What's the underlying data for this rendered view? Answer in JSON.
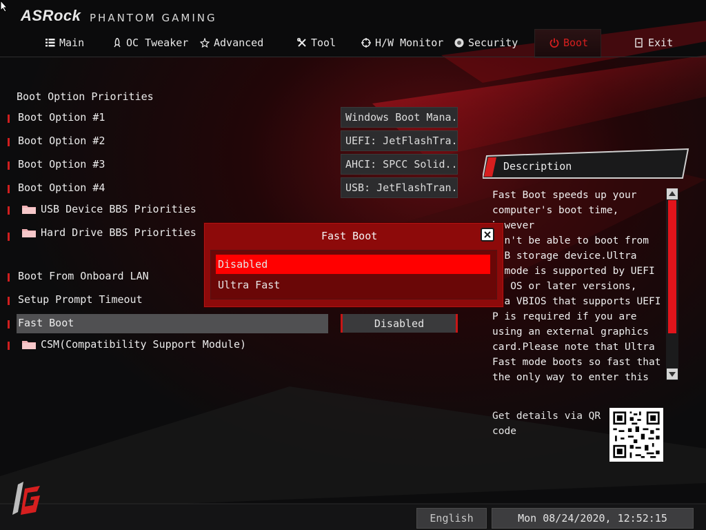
{
  "brand": {
    "logo": "ASRock",
    "subtitle": "PHANTOM GAMING"
  },
  "nav": {
    "tabs": [
      {
        "label": "Main",
        "icon": "list-icon"
      },
      {
        "label": "OC Tweaker",
        "icon": "rocket-icon"
      },
      {
        "label": "Advanced",
        "icon": "star-icon"
      },
      {
        "label": "Tool",
        "icon": "tools-icon"
      },
      {
        "label": "H/W Monitor",
        "icon": "target-icon"
      },
      {
        "label": "Security",
        "icon": "shield-icon"
      },
      {
        "label": "Boot",
        "icon": "power-icon",
        "active": true
      },
      {
        "label": "Exit",
        "icon": "exit-icon"
      }
    ]
  },
  "main": {
    "section_title": "Boot Option Priorities",
    "boot_options": [
      {
        "label": "Boot Option #1",
        "value": "Windows Boot Mana..."
      },
      {
        "label": "Boot Option #2",
        "value": "UEFI: JetFlashTra..."
      },
      {
        "label": "Boot Option #3",
        "value": "AHCI:  SPCC Solid..."
      },
      {
        "label": "Boot Option #4",
        "value": "USB: JetFlashTran..."
      }
    ],
    "folders": [
      {
        "label": "USB Device BBS Priorities"
      },
      {
        "label": "Hard Drive BBS Priorities"
      }
    ],
    "settings": [
      {
        "label": "Boot From Onboard LAN"
      },
      {
        "label": "Setup Prompt Timeout"
      }
    ],
    "fast_boot": {
      "label": "Fast Boot",
      "value": "Disabled"
    },
    "csm": {
      "label": "CSM(Compatibility Support Module)"
    }
  },
  "popup": {
    "title": "Fast Boot",
    "options": [
      {
        "label": "Disabled",
        "selected": true
      },
      {
        "label": "Ultra Fast"
      }
    ]
  },
  "description": {
    "title": "Description",
    "lines": [
      "Fast Boot speeds up your",
      "computer's boot time, however",
      "  won't be able to boot from",
      "  USB storage device.Ultra",
      "  t mode is supported by UEFI",
      "  re OS or later versions,",
      "  d a VBIOS that supports UEFI",
      "  P is required if you are",
      "using an external graphics",
      "card.Please note that Ultra",
      "Fast mode boots so fast that",
      "the only way to enter this"
    ],
    "qr_text": "Get details via QR code"
  },
  "footer": {
    "language": "English",
    "datetime": "Mon 08/24/2020, 12:52:15"
  },
  "colors": {
    "accent": "#d61f1f",
    "popup_bg": "#8d0a0a",
    "selection": "#ff0000"
  }
}
